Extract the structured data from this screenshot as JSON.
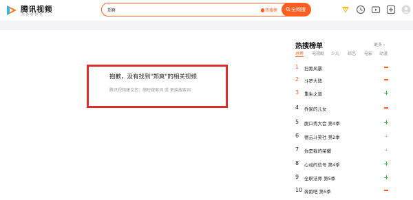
{
  "header": {
    "logo_title": "腾讯视频",
    "logo_slogan": "不负好时光",
    "search_value": "郑爽",
    "hot_search_label": "热搜榜",
    "search_button_label": "全网搜"
  },
  "notice": {
    "title": "抱歉，没有找到\"郑爽\"的相关视频",
    "suggestion": "腾讯视频建议您：缩短搜索词 或 更换搜索词"
  },
  "ranking": {
    "title": "热搜榜单",
    "more_label": "更多",
    "tabs": [
      "总榜",
      "电视剧",
      "少儿",
      "综艺",
      "电影",
      "动漫"
    ],
    "active_tab": "总榜",
    "items": [
      {
        "rank": "1",
        "name": "扫黑风暴",
        "trend": "same"
      },
      {
        "rank": "2",
        "name": "斗罗大陆",
        "trend": "same"
      },
      {
        "rank": "3",
        "name": "重生之道",
        "trend": "up"
      },
      {
        "rank": "4",
        "name": "乔家的儿女",
        "trend": "same"
      },
      {
        "rank": "5",
        "name": "脱口秀大会 第4季",
        "trend": "up"
      },
      {
        "rank": "6",
        "name": "德云斗笑社 第2季",
        "trend": "new"
      },
      {
        "rank": "7",
        "name": "你是我的荣耀",
        "trend": "new"
      },
      {
        "rank": "8",
        "name": "心动的信号 第4季",
        "trend": "up"
      },
      {
        "rank": "9",
        "name": "全职法师 第5季",
        "trend": "up"
      },
      {
        "rank": "10",
        "name": "奔跑吧 第5季",
        "trend": "same"
      }
    ]
  },
  "colors": {
    "accent": "#ff6022",
    "highlight_border": "#e02b2b",
    "trend_up": "#3bb54a",
    "trend_same": "#ff6022",
    "trend_new": "#c8c8c8"
  }
}
